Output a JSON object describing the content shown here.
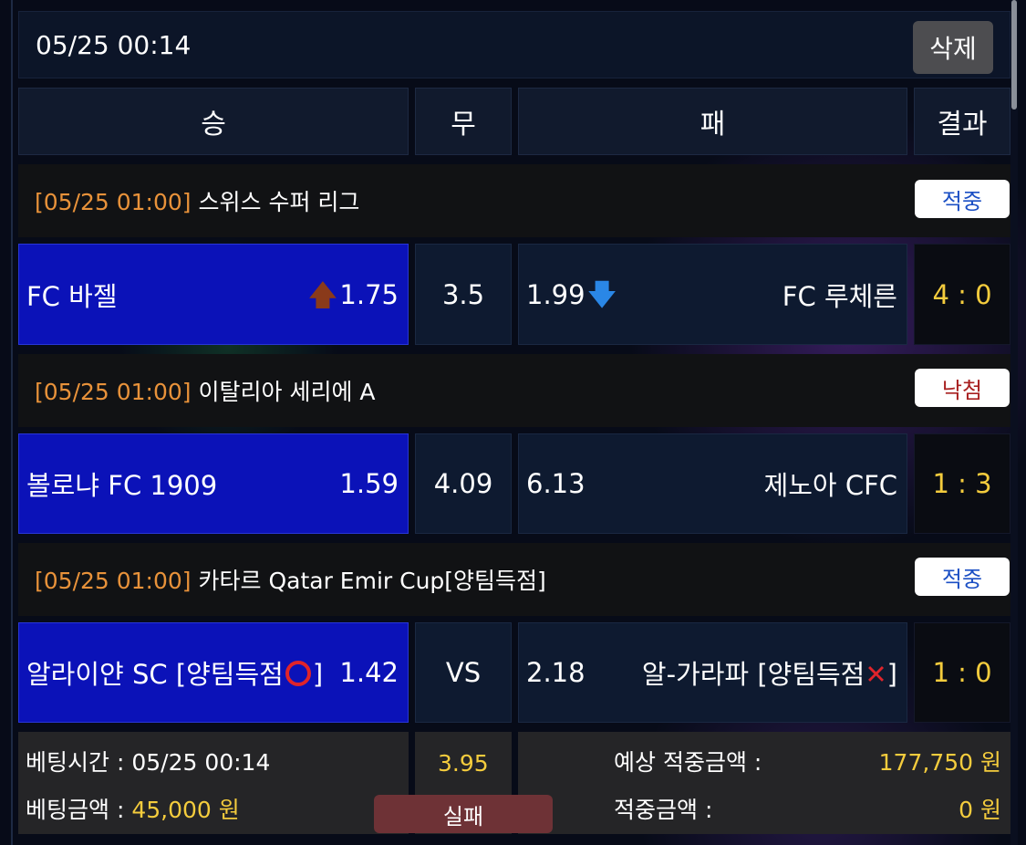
{
  "header": {
    "datetime": "05/25 00:14",
    "delete_label": "삭제"
  },
  "columns": {
    "win": "승",
    "draw": "무",
    "lose": "패",
    "result": "결과"
  },
  "matches": [
    {
      "league_time": "[05/25 01:00]",
      "league_name": "스위스 수퍼 리그",
      "status": "적중",
      "status_color": "#1b4fc4",
      "home_team": "FC 바젤",
      "home_odds": "1.75",
      "home_arrow": "up",
      "draw": "3.5",
      "away_odds": "1.99",
      "away_arrow": "down",
      "away_team": "FC 루체른",
      "score": "4 : 0"
    },
    {
      "league_time": "[05/25 01:00]",
      "league_name": "이탈리아 세리에 A",
      "status": "낙첨",
      "status_color": "#a82020",
      "home_team": "볼로냐 FC 1909",
      "home_odds": "1.59",
      "draw": "4.09",
      "away_odds": "6.13",
      "away_team": "제노아 CFC",
      "score": "1 : 3"
    },
    {
      "league_time": "[05/25 01:00]",
      "league_name": "카타르 Qatar Emir Cup[양팀득점]",
      "status": "적중",
      "status_color": "#1b4fc4",
      "home_team_prefix": "알라이얀 SC [양팀득점",
      "home_team_suffix": "]",
      "home_mark": "circle-o",
      "home_odds": "1.42",
      "draw": "VS",
      "away_odds": "2.18",
      "away_team_prefix": "알-가라파 [양팀득점",
      "away_team_suffix": "]",
      "away_mark": "cross-x",
      "score": "1 : 0"
    }
  ],
  "summary": {
    "bet_time_label": "베팅시간 : ",
    "bet_time": "05/25 00:14",
    "bet_amount_label": "베팅금액 : ",
    "bet_amount": "45,000 원",
    "total_odds": "3.95",
    "result_label": "실패",
    "expected_label": "예상 적중금액 :",
    "expected_amount": "177,750 원",
    "won_label": "적중금액 :",
    "won_amount": "0 원"
  }
}
